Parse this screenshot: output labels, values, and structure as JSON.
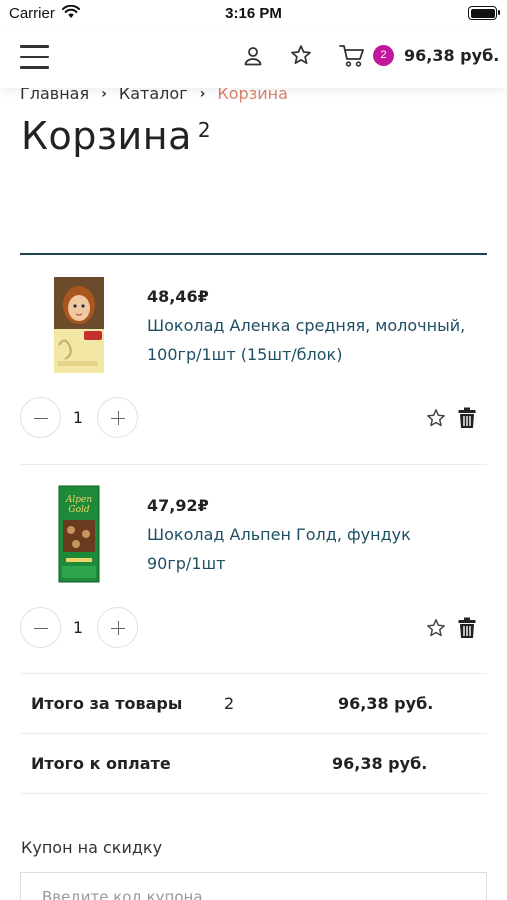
{
  "status_bar": {
    "carrier": "Carrier",
    "time": "3:16 PM"
  },
  "header": {
    "cart_count": "2",
    "cart_total": "96,38 руб."
  },
  "breadcrumb": {
    "home": "Главная",
    "catalog": "Каталог",
    "current": "Корзина"
  },
  "page": {
    "title": "Корзина",
    "count": "2"
  },
  "items": [
    {
      "price": "48,46₽",
      "name": "Шоколад Аленка средняя, молочный, 100гр/1шт (15шт/блок)",
      "quantity": "1",
      "image": "alenka-chocolate-image"
    },
    {
      "price": "47,92₽",
      "name": "Шоколад Альпен Голд, фундук 90гр/1шт",
      "quantity": "1",
      "image": "alpen-gold-chocolate-image"
    }
  ],
  "totals": {
    "goods_label": "Итого за товары",
    "goods_count": "2",
    "goods_sum": "96,38 руб.",
    "pay_label": "Итого к оплате",
    "pay_sum": "96,38 руб."
  },
  "coupon": {
    "label": "Купон на скидку",
    "placeholder": "Введите код купона",
    "value": ""
  },
  "colors": {
    "badge": "#c0179b",
    "link": "#1f4f63",
    "breadcrumb_current": "#d9826b",
    "rule": "#1f4255"
  }
}
